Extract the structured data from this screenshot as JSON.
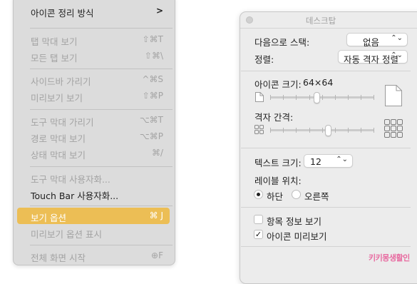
{
  "menu": {
    "items": [
      {
        "label": "아이콘 정리 방식",
        "shortcut": "",
        "submenu": ">"
      },
      {
        "label": "탭 막대 보기",
        "shortcut": "⇧⌘T"
      },
      {
        "label": "모든 탭 보기",
        "shortcut": "⇧⌘\\"
      },
      {
        "label": "사이드바 가리기",
        "shortcut": "^⌘S"
      },
      {
        "label": "미리보기 보기",
        "shortcut": "⇧⌘P"
      },
      {
        "label": "도구 막대 가리기",
        "shortcut": "⌥⌘T"
      },
      {
        "label": "경로 막대 보기",
        "shortcut": "⌥⌘P"
      },
      {
        "label": "상태 막대 보기",
        "shortcut": "⌘/"
      },
      {
        "label": "도구 막대 사용자화...",
        "shortcut": ""
      },
      {
        "label": "Touch Bar 사용자화...",
        "shortcut": ""
      },
      {
        "label": "보기 옵션",
        "shortcut": "⌘ J"
      },
      {
        "label": "미리보기 옵션 표시",
        "shortcut": ""
      },
      {
        "label": "전체 화면 시작",
        "shortcut": "⊕F"
      }
    ]
  },
  "settings": {
    "title": "데스크탑",
    "stack_label": "다음으로 스택:",
    "stack_value": "없음",
    "sort_label": "정렬:",
    "sort_value": "자동 격자 정렬",
    "icon_size_label": "아이콘 크기:",
    "icon_size_value": "64×64",
    "grid_spacing_label": "격자 간격:",
    "text_size_label": "텍스트 크기:",
    "text_size_value": "12",
    "label_pos_label": "레이블 위치:",
    "label_pos_bottom": "하단",
    "label_pos_right": "오른쪽",
    "show_item_info": "항목 정보 보기",
    "show_icon_preview": "아이콘 미리보기",
    "icon_size_level": 0.45,
    "grid_spacing_level": 0.56
  },
  "watermark": "키키몽생활인",
  "colors": {
    "highlight": "#ecbe55",
    "menu_bg": "#dcdcdc",
    "window_bg": "#ececec",
    "watermark": "#e86aa0"
  }
}
